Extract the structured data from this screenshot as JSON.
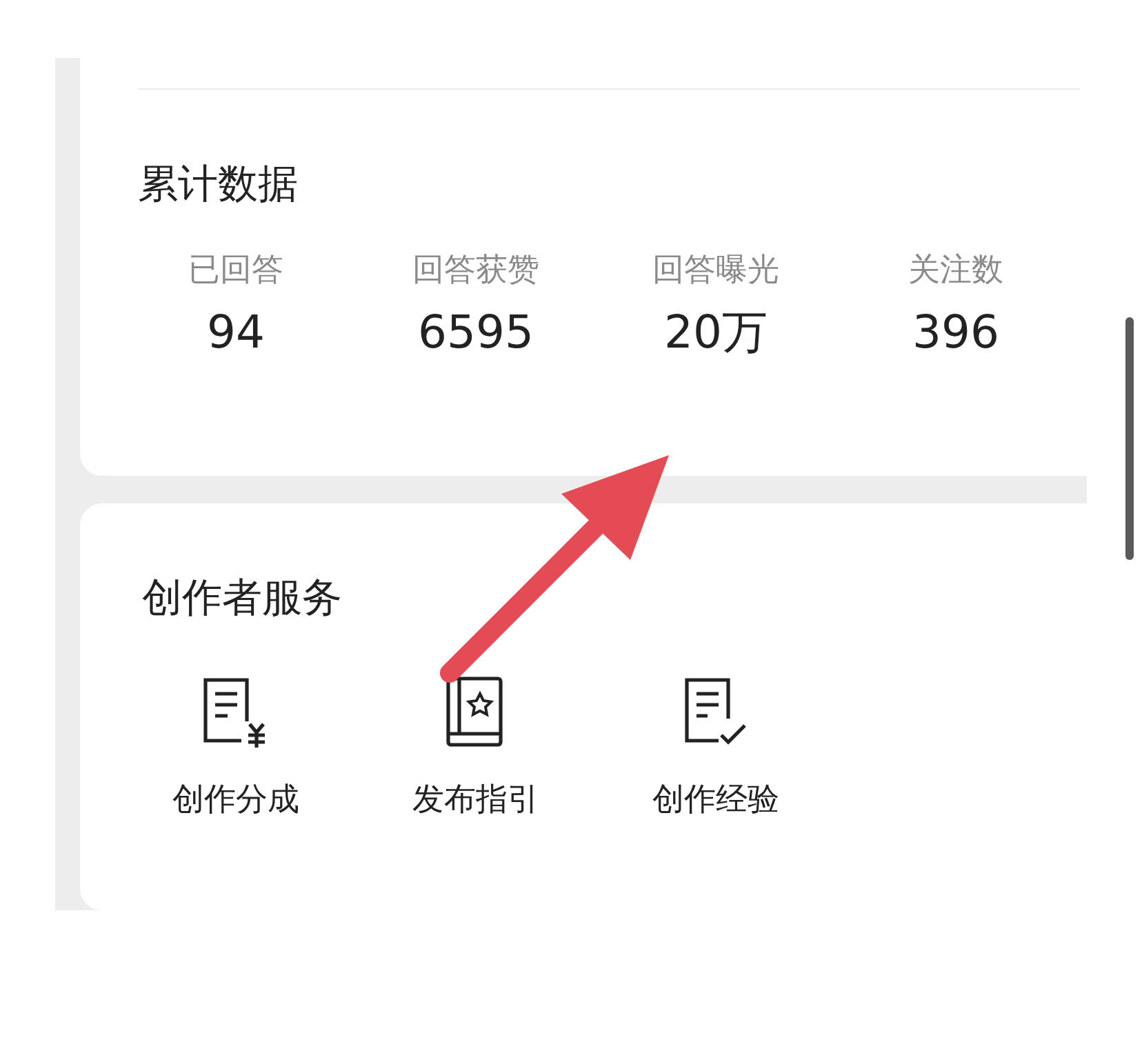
{
  "cumulative": {
    "title": "累计数据",
    "stats": [
      {
        "label": "已回答",
        "value": "94"
      },
      {
        "label": "回答获赞",
        "value": "6595"
      },
      {
        "label": "回答曝光",
        "value": "20万"
      },
      {
        "label": "关注数",
        "value": "396"
      }
    ]
  },
  "creator_services": {
    "title": "创作者服务",
    "items": [
      {
        "kind": "revenue",
        "label": "创作分成"
      },
      {
        "kind": "guide",
        "label": "发布指引"
      },
      {
        "kind": "experience",
        "label": "创作经验"
      }
    ]
  }
}
